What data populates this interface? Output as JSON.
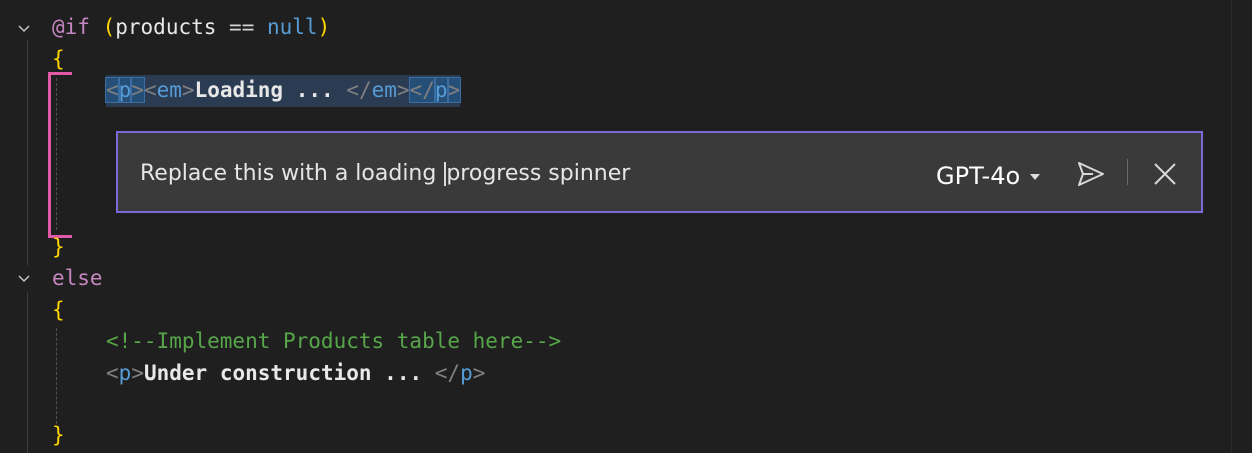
{
  "editor": {
    "line1": {
      "at": "@if",
      "open_paren": "(",
      "ident": "products",
      "op": " == ",
      "null": "null",
      "close_paren": ")"
    },
    "line2": {
      "brace": "{"
    },
    "line3": {
      "lt1": "<",
      "p": "p",
      "gt1": ">",
      "lt2": "<",
      "em": "em",
      "gt2": ">",
      "text": "Loading ... ",
      "lt3": "</",
      "em2": "em",
      "gt3": ">",
      "lt4": "</",
      "p2": "p",
      "gt4": ">"
    },
    "line4": {
      "brace": "}"
    },
    "line5": {
      "else": "else"
    },
    "line6": {
      "brace": "{"
    },
    "line7": {
      "comment": "<!--Implement Products table here-->"
    },
    "line8": {
      "lt1": "<",
      "p": "p",
      "gt1": ">",
      "text": "Under construction ... ",
      "lt2": "</",
      "p2": "p",
      "gt2": ">"
    },
    "line9": {
      "brace": "}"
    }
  },
  "inline_chat": {
    "input_text_before_caret": "Replace this with a loading ",
    "input_text_after_caret": "progress spinner",
    "model_label": "GPT-4o",
    "icons": {
      "dropdown": "chevron-down-icon",
      "send": "send-icon",
      "close": "close-icon"
    },
    "border_color": "#7a6ad8"
  },
  "colors": {
    "background": "#1f1f1f",
    "keyword": "#c586c0",
    "bracket": "#ffd700",
    "tag": "#569cd6",
    "comment": "#57a64a",
    "diff_marker": "#e05aa8"
  }
}
